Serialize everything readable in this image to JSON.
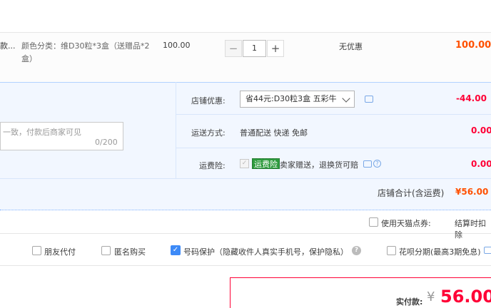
{
  "product": {
    "name": "款...",
    "attr": "颜色分类：维D30粒*3盒（送赠品*2盒）",
    "price": "100.00",
    "quantity": "1",
    "discount": "无优惠",
    "total": "100.00"
  },
  "message": {
    "placeholder": "一致，付款后商家可见",
    "count": "0/200"
  },
  "shop_discount": {
    "label": "店铺优惠:",
    "selected": "省44元:D30粒3盒 五彩牛",
    "amount": "-44.00"
  },
  "shipping": {
    "label": "运送方式:",
    "value": "普通配送 快递 免邮",
    "amount": "0.00"
  },
  "insurance": {
    "label": "运费险:",
    "badge": "运费险",
    "text": "卖家赠送，退换货可赔",
    "amount": "0.00"
  },
  "shop_total": {
    "label": "店铺合计(含运费)",
    "value": "¥56.00"
  },
  "coupon": {
    "label": "使用天猫点券:",
    "settle_text": "结算时扣除"
  },
  "options": {
    "friend_pay": "朋友代付",
    "anonymous": "匿名购买",
    "phone_protect": "号码保护（隐藏收件人真实手机号，保护隐私）",
    "huabei": "花呗分期(最高3期免息)"
  },
  "payment": {
    "label": "实付款:",
    "currency": "¥",
    "amount": "56.00"
  },
  "colors": {
    "accent_red": "#ff0036",
    "orange": "#ff5000",
    "blue_bg": "#f2f7ff",
    "check_blue": "#3d8af7",
    "insurance_green": "#2e9b3e"
  }
}
